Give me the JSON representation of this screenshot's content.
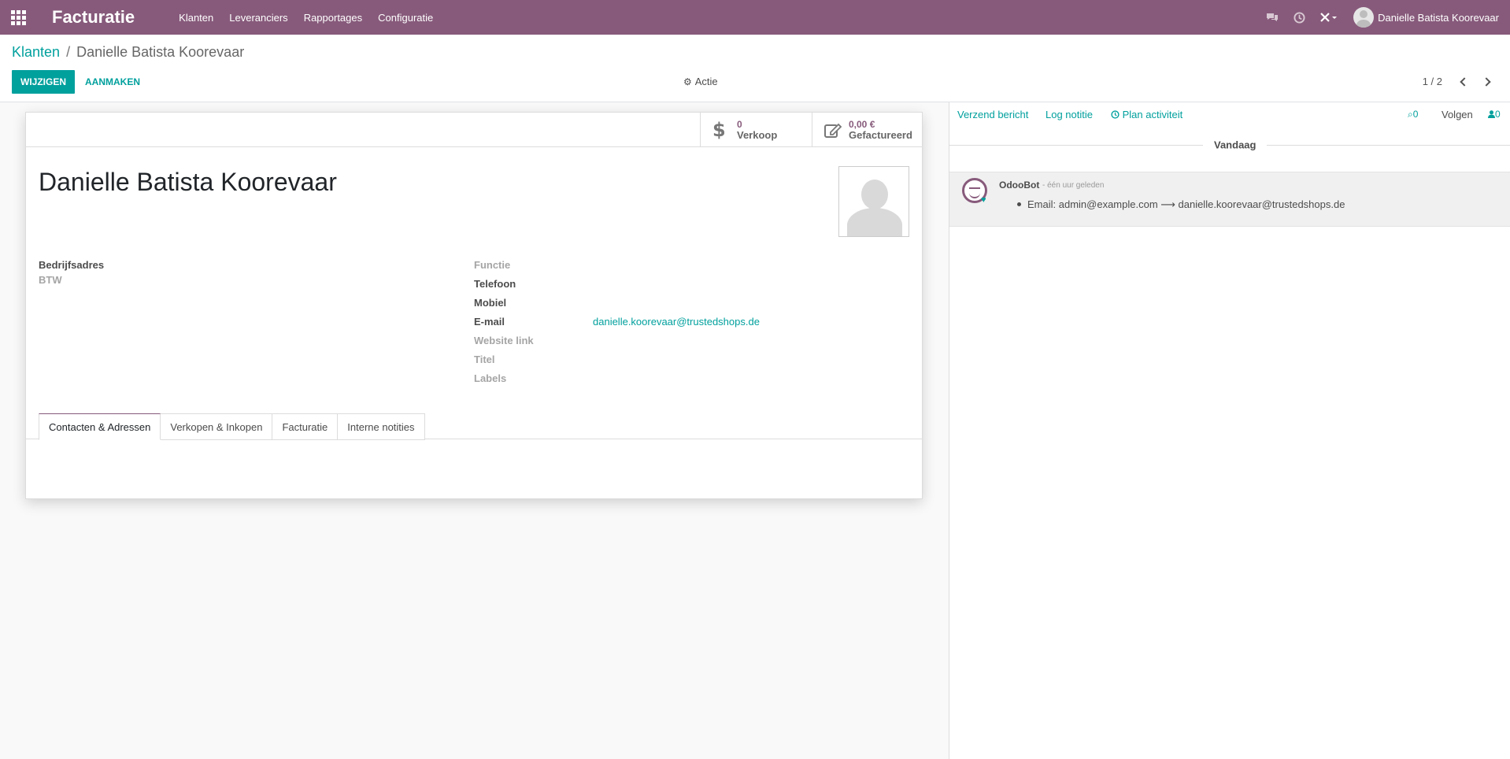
{
  "navbar": {
    "brand": "Facturatie",
    "menu": [
      "Klanten",
      "Leveranciers",
      "Rapportages",
      "Configuratie"
    ],
    "user_name": "Danielle Batista Koorevaar"
  },
  "control_panel": {
    "breadcrumb_parent": "Klanten",
    "breadcrumb_separator": "/",
    "breadcrumb_current": "Danielle Batista Koorevaar",
    "edit_label": "WIJZIGEN",
    "create_label": "AANMAKEN",
    "action_label": "Actie",
    "pager": "1 / 2"
  },
  "stats": {
    "sales_value": "0",
    "sales_label": "Verkoop",
    "invoiced_value": "0,00 €",
    "invoiced_label": "Gefactureerd"
  },
  "partner": {
    "name": "Danielle Batista Koorevaar",
    "email": "danielle.koorevaar@trustedshops.de"
  },
  "fields": {
    "company_address": "Bedrijfsadres",
    "vat": "BTW",
    "function": "Functie",
    "phone": "Telefoon",
    "mobile": "Mobiel",
    "email": "E-mail",
    "website": "Website link",
    "title": "Titel",
    "tags": "Labels"
  },
  "tabs": [
    "Contacten & Adressen",
    "Verkopen & Inkopen",
    "Facturatie",
    "Interne notities"
  ],
  "chatter": {
    "send_message": "Verzend bericht",
    "log_note": "Log notitie",
    "plan_activity": "Plan activiteit",
    "attachments_count": "0",
    "follow": "Volgen",
    "followers_count": "0",
    "date_separator": "Vandaag",
    "message": {
      "author": "OdooBot",
      "time": "- één uur geleden",
      "text": "Email: admin@example.com ⟶ danielle.koorevaar@trustedshops.de"
    }
  },
  "colors": {
    "brand": "#875a7b",
    "accent": "#00a09d"
  },
  "icons": {
    "apps": "apps-grid-icon",
    "chat": "chat-icon",
    "activity": "clock-icon",
    "debug": "bug-icon",
    "action": "gear-icon",
    "sales": "dollar-icon",
    "invoiced": "pencil-square-icon",
    "plan": "clock-icon",
    "attachment": "paperclip-icon",
    "followers": "user-icon"
  }
}
